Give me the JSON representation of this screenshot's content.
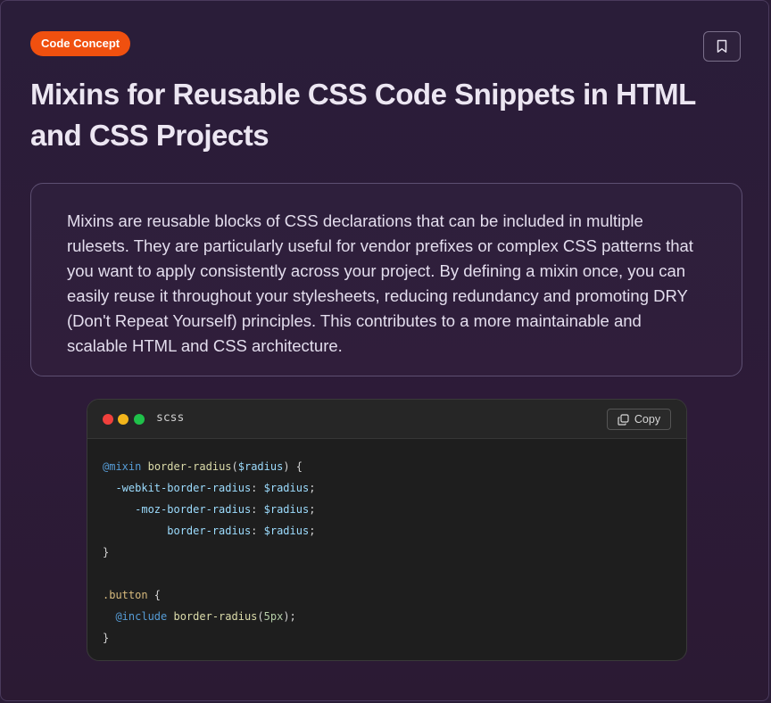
{
  "badge": "Code Concept",
  "title": "Mixins for Reusable CSS Code Snippets in HTML and CSS Projects",
  "description": "Mixins are reusable blocks of CSS declarations that can be included in multiple rulesets. They are particularly useful for vendor prefixes or complex CSS patterns that you want to apply consistently across your project. By defining a mixin once, you can easily reuse it throughout your stylesheets, reducing redundancy and promoting DRY (Don't Repeat Yourself) principles. This contributes to a more maintainable and scalable HTML and CSS architecture.",
  "code_block": {
    "language": "scss",
    "copy_label": "Copy",
    "lines": {
      "l1": {
        "kw": "@mixin",
        "fn": "border-radius",
        "p1": "(",
        "var": "$radius",
        "p2": ") {"
      },
      "l2": {
        "prop": "-webkit-border-radius",
        "colon": ": ",
        "var": "$radius",
        "semi": ";"
      },
      "l3": {
        "prop": "-moz-border-radius",
        "colon": ": ",
        "var": "$radius",
        "semi": ";"
      },
      "l4": {
        "prop": "border-radius",
        "colon": ": ",
        "var": "$radius",
        "semi": ";"
      },
      "l5": "}",
      "l7": {
        "sel": ".button",
        "brace": " {"
      },
      "l8": {
        "kw": "@include",
        "fn": "border-radius",
        "p1": "(",
        "num": "5px",
        "p2": ");"
      },
      "l9": "}"
    }
  },
  "icons": {
    "bookmark": "bookmark-icon",
    "copy": "copy-icon",
    "window_close": "red-dot",
    "window_minimize": "yellow-dot",
    "window_maximize": "green-dot"
  },
  "colors": {
    "badge_bg": "#f0500f",
    "card_bg": "#2a1d39",
    "code_bg": "#1e1e1e"
  }
}
